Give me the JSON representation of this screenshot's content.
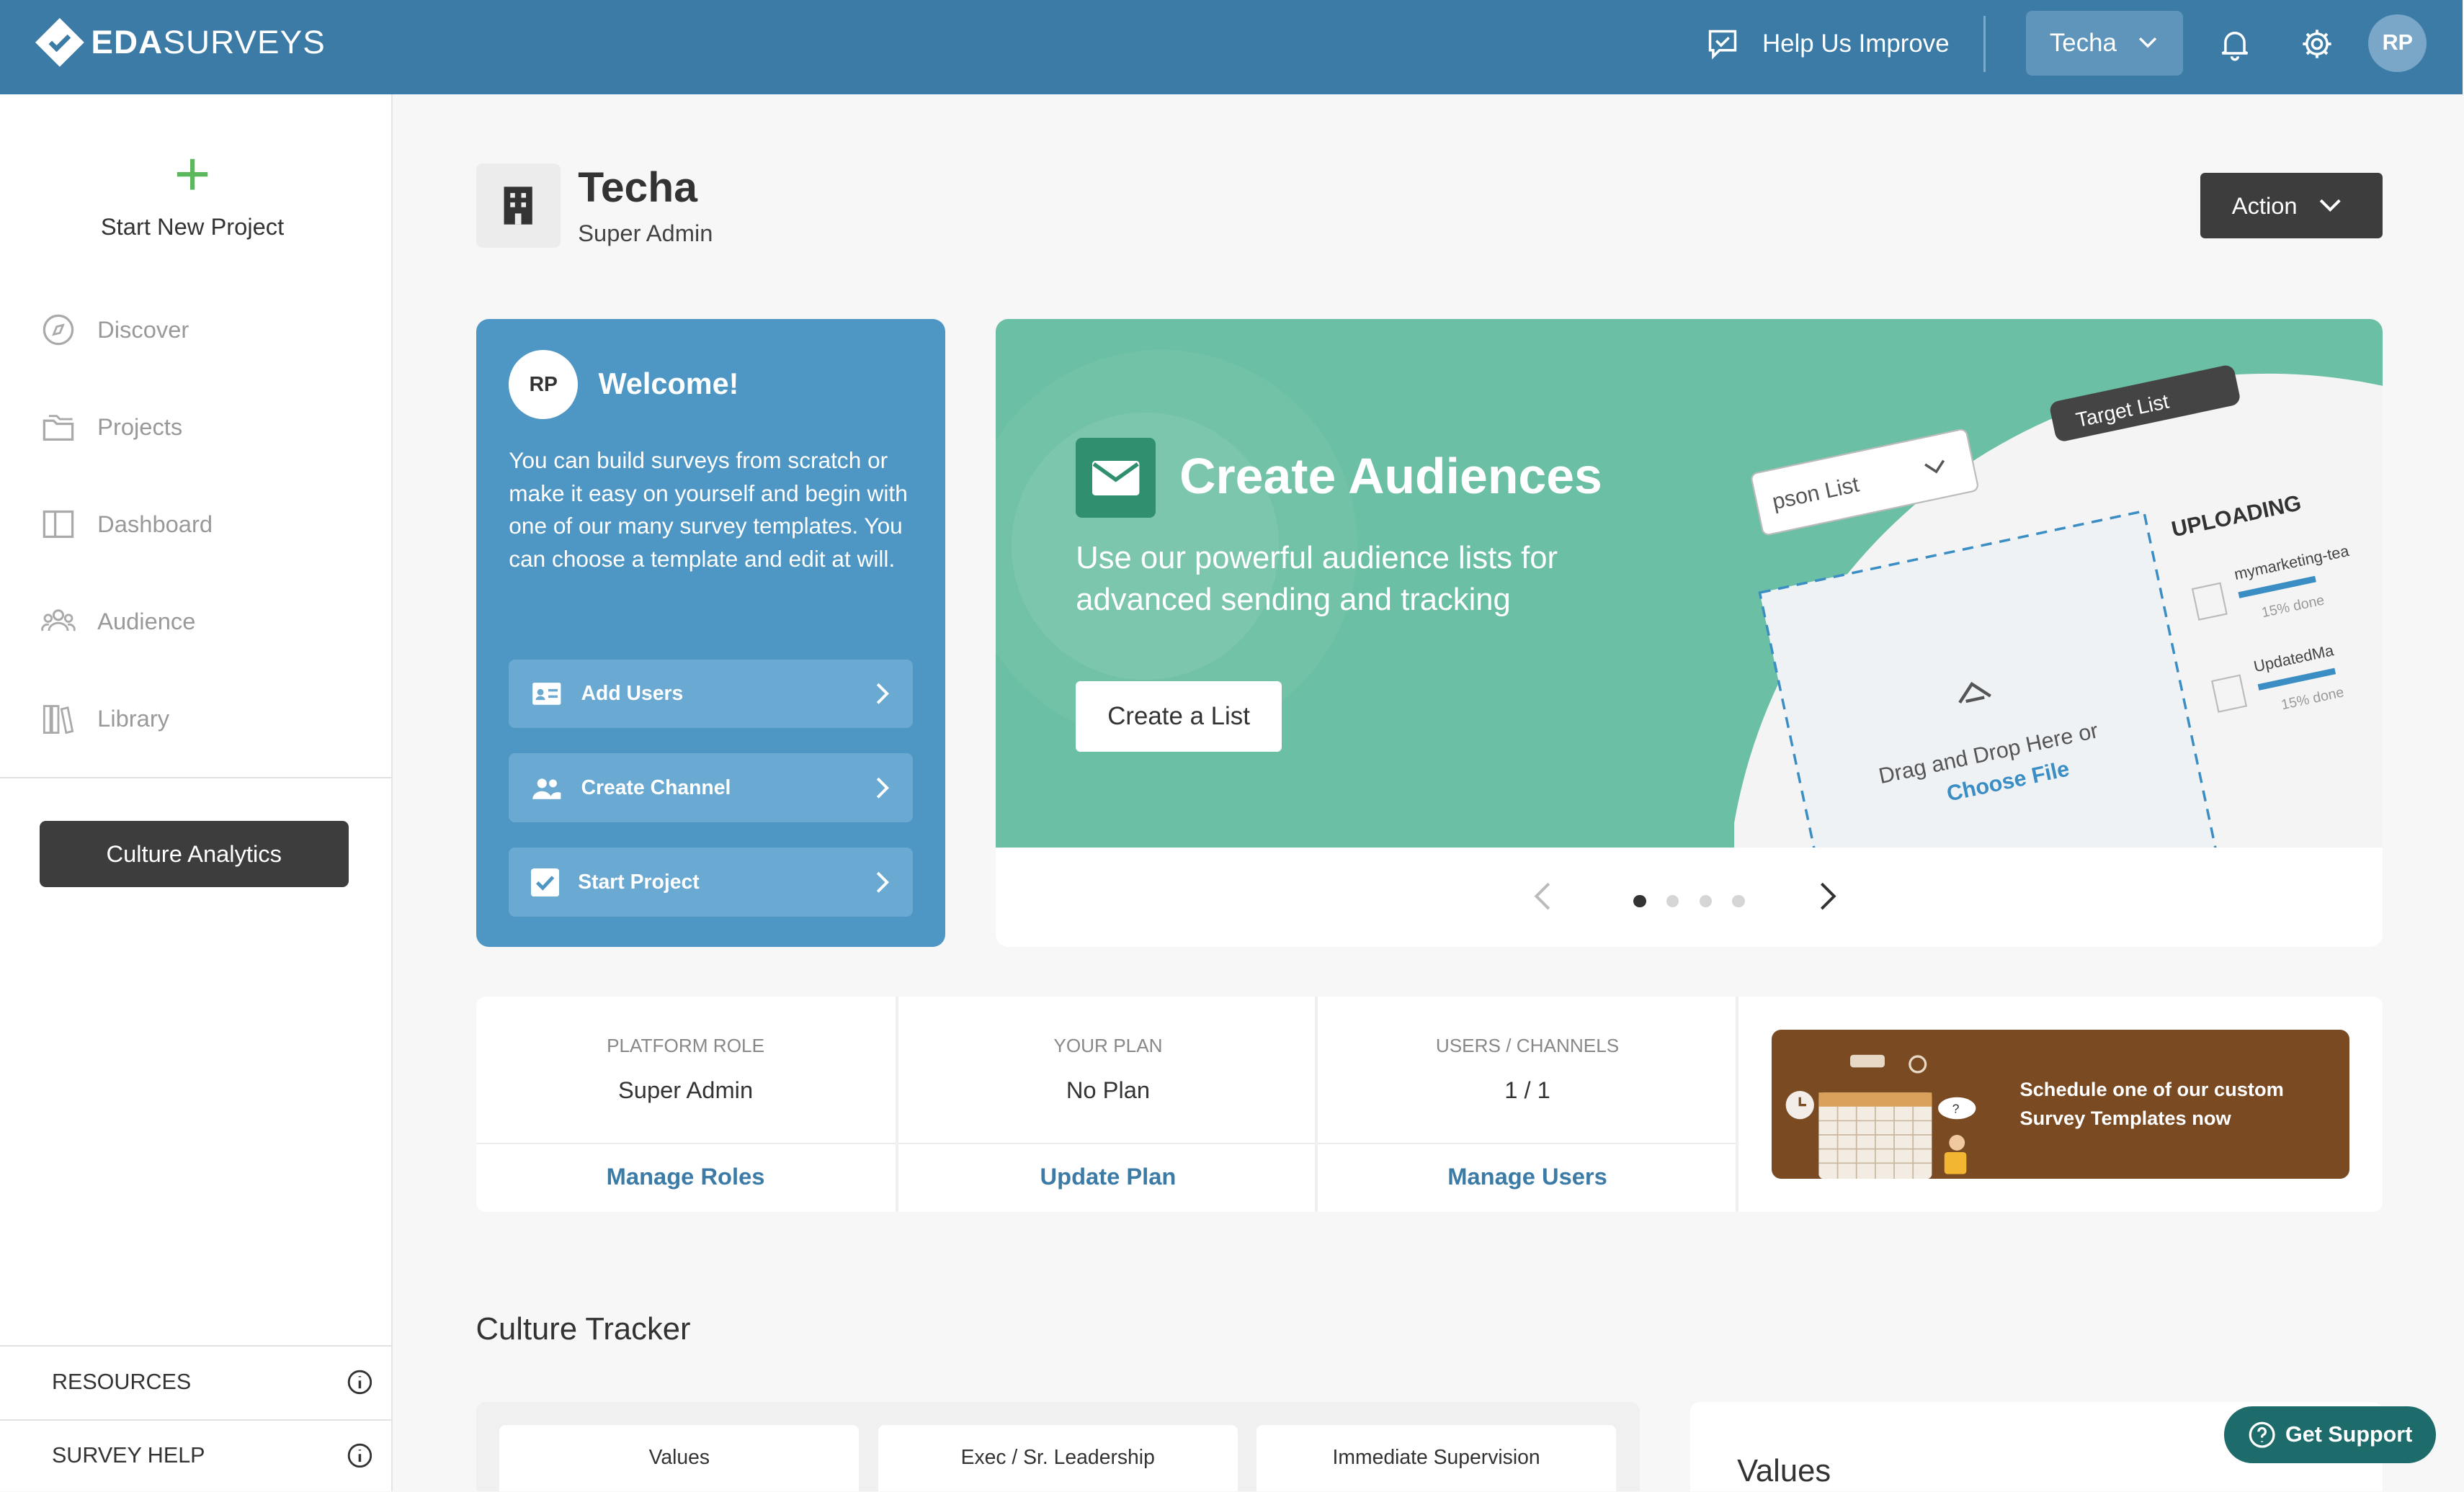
{
  "brand": {
    "logo_bold": "EDA",
    "logo_light": "SURVEYS"
  },
  "topbar": {
    "help_improve": "Help Us Improve",
    "company": "Techa",
    "avatar_initials": "RP"
  },
  "sidebar": {
    "new_project": "Start New Project",
    "items": [
      {
        "label": "Discover",
        "icon": "compass-icon"
      },
      {
        "label": "Projects",
        "icon": "folders-icon"
      },
      {
        "label": "Dashboard",
        "icon": "dashboard-icon"
      },
      {
        "label": "Audience",
        "icon": "people-icon"
      },
      {
        "label": "Library",
        "icon": "books-icon"
      }
    ],
    "culture_analytics": "Culture Analytics",
    "resources": "RESOURCES",
    "survey_help": "SURVEY HELP"
  },
  "header": {
    "org_name": "Techa",
    "org_role": "Super Admin",
    "action": "Action"
  },
  "welcome": {
    "avatar_initials": "RP",
    "title": "Welcome!",
    "body": "You can build surveys from scratch or make it easy on yourself and begin with one of our many survey templates. You can choose a template and edit at will.",
    "buttons": [
      "Add Users",
      "Create Channel",
      "Start Project"
    ]
  },
  "carousel": {
    "title": "Create Audiences",
    "subtitle": "Use our powerful audience lists for advanced sending and tracking",
    "button": "Create a List",
    "illustration": {
      "dropdown": "pson List",
      "tag": "Target List",
      "uploading": "UPLOADING",
      "file1": "mymarketing-tea",
      "file1_status": "15% done",
      "file2": "UpdatedMa",
      "file2_status": "15% done",
      "drop_text": "Drag and Drop Here or",
      "choose_file": "Choose File"
    },
    "dot_count": 4,
    "active_dot": 0
  },
  "stats": [
    {
      "label": "PLATFORM ROLE",
      "value": "Super Admin",
      "link": "Manage Roles"
    },
    {
      "label": "YOUR PLAN",
      "value": "No Plan",
      "link": "Update Plan"
    },
    {
      "label": "USERS / CHANNELS",
      "value": "1 / 1",
      "link": "Manage Users"
    }
  ],
  "promo": {
    "text": "Schedule one of our custom Survey Templates now"
  },
  "culture_tracker": {
    "title": "Culture Tracker",
    "tabs": [
      "Values",
      "Exec / Sr. Leadership",
      "Immediate Supervision"
    ],
    "values_title": "Values"
  },
  "support": {
    "label": "Get Support"
  },
  "colors": {
    "topbar": "#3b7ba6",
    "welcome": "#4e96c4",
    "carousel": "#6bbfa4",
    "accent_link": "#3b7ba6",
    "support": "#1e6b6b",
    "plus": "#5cb85c"
  }
}
